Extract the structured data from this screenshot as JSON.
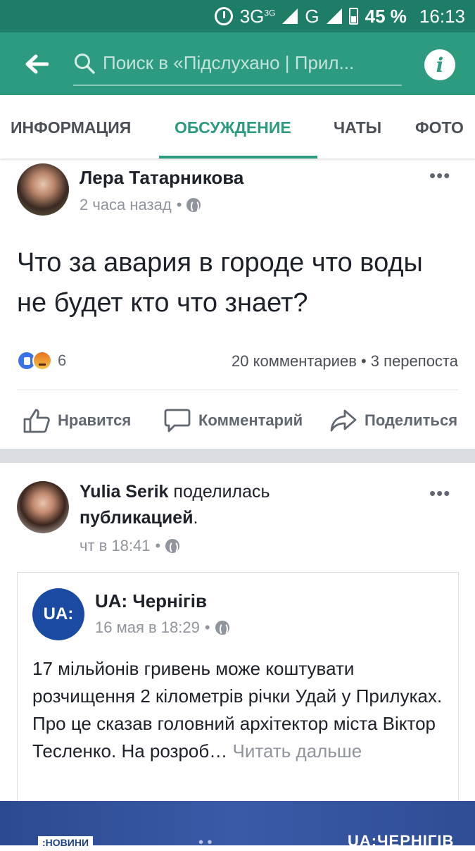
{
  "status_bar": {
    "network": "3G",
    "network_sup": "3G",
    "network2": "G",
    "battery": "45 %",
    "time": "16:13"
  },
  "header": {
    "search_placeholder": "Поиск в «Підслухано | Прил...",
    "icons": {
      "back": "back-arrow-icon",
      "search": "search-icon",
      "info": "info-icon"
    }
  },
  "tabs": [
    "ИНФОРМАЦИЯ",
    "ОБСУЖДЕНИЕ",
    "ЧАТЫ",
    "ФОТО"
  ],
  "active_tab": "ОБСУЖДЕНИЕ",
  "post1": {
    "author": "Лера Татарникова",
    "time": "2 часа назад",
    "text": "Что за авария в городе что воды не будет кто что знает?",
    "reaction_count": "6",
    "stats": "20 комментариев • 3 перепоста",
    "actions": {
      "like": "Нравится",
      "comment": "Комментарий",
      "share": "Поделиться"
    }
  },
  "post2": {
    "author": "Yulia Serik",
    "action_text": "поделилась",
    "object_text": "публикацией",
    "period": ".",
    "time": "чт в 18:41",
    "shared": {
      "page_name": "UA: Чернігів",
      "logo_text": "UA:",
      "time": "16 мая в 18:29",
      "text": "17 мільйонів гривень може коштувати розчищення 2 кілометрів річки Удай у Прилуках. Про це сказав головний архітектор міста Віктор Тесленко.  На розроб…",
      "read_more": "Читать дальше"
    }
  },
  "banner": {
    "left_badge": ":НОВИНИ",
    "right_text": "UA:ЧЕРНІГІВ"
  },
  "colors": {
    "header": "#2d9b7f",
    "status_bar": "#1e7d66",
    "accent": "#2d9b7f",
    "like_blue": "#3b72e6",
    "separator": "#dadde1"
  }
}
